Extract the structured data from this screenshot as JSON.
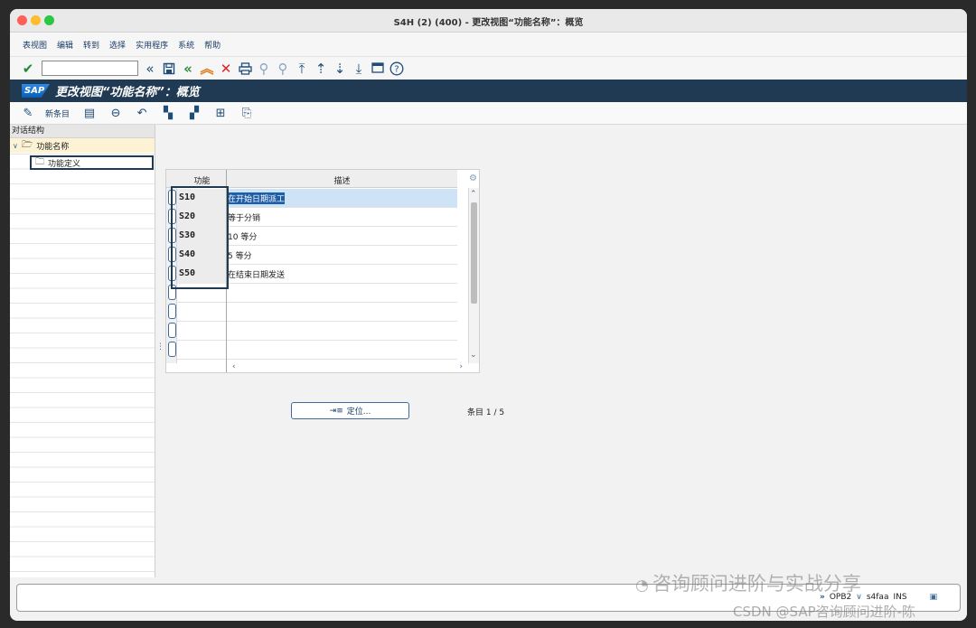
{
  "window": {
    "title": "S4H (2) (400) - 更改视图“功能名称”：概览"
  },
  "menu": [
    "表视图",
    "编辑",
    "转到",
    "选择",
    "实用程序",
    "系统",
    "帮助"
  ],
  "toolbar": {
    "command_value": ""
  },
  "header": {
    "title": "更改视图“功能名称”：概览",
    "logo": "SAP"
  },
  "app_toolbar": {
    "new_entries": "新条目"
  },
  "nav": {
    "heading": "对话结构",
    "node_root": "功能名称",
    "node_child": "功能定义"
  },
  "table": {
    "columns": [
      "功能",
      "描述"
    ],
    "rows": [
      {
        "code": "S10",
        "desc": "在开始日期派工"
      },
      {
        "code": "S20",
        "desc": "等于分销"
      },
      {
        "code": "S30",
        "desc": "10 等分"
      },
      {
        "code": "S40",
        "desc": "5 等分"
      },
      {
        "code": "S50",
        "desc": "在结束日期发送"
      }
    ]
  },
  "position_button": "定位...",
  "entry_count": "条目 1 / 5",
  "status": {
    "client": "OPB2",
    "server": "s4faa",
    "mode": "INS"
  },
  "watermark": {
    "line1": "咨询顾问进阶与实战分享",
    "line2": "CSDN @SAP咨询顾问进阶-陈"
  }
}
